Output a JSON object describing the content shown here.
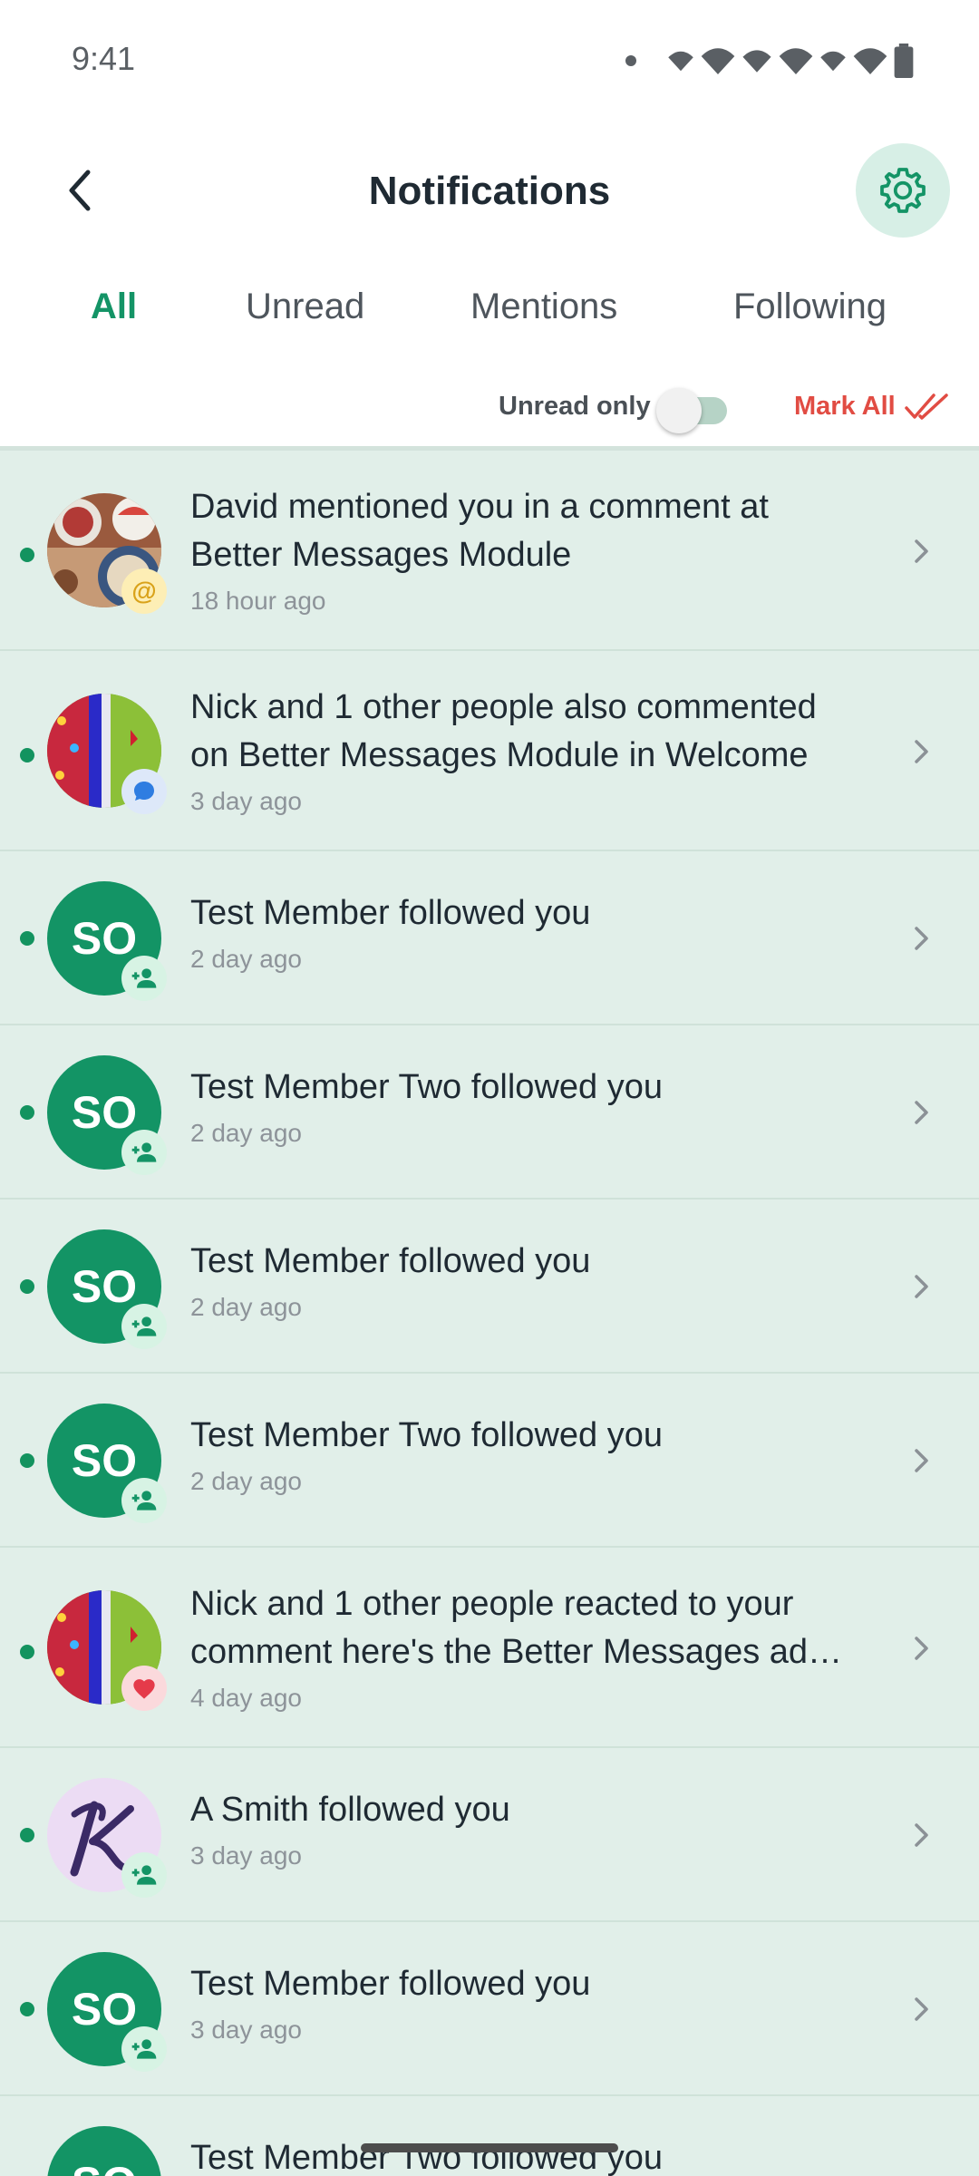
{
  "status_bar": {
    "time": "9:41"
  },
  "header": {
    "title": "Notifications"
  },
  "tabs": [
    {
      "label": "All",
      "active": true
    },
    {
      "label": "Unread",
      "active": false
    },
    {
      "label": "Mentions",
      "active": false
    },
    {
      "label": "Following",
      "active": false
    }
  ],
  "filters": {
    "unread_only_label": "Unread only",
    "unread_only_enabled": false,
    "mark_all_label": "Mark All"
  },
  "notifications": [
    {
      "title_lines": [
        "David mentioned you in a comment at",
        "Better Messages Module"
      ],
      "time": "18 hour ago",
      "avatar": "photo-fruit",
      "badge": "mention-icon",
      "unread": true
    },
    {
      "title_lines": [
        "Nick and 1 other people also commented",
        "on Better Messages Module in Welcome"
      ],
      "time": "3 day ago",
      "avatar": "photo-stadium",
      "badge": "comment-icon",
      "unread": true
    },
    {
      "title_lines": [
        "Test Member followed you"
      ],
      "time": "2 day ago",
      "avatar_initials": "SO",
      "badge": "follow-icon",
      "unread": true
    },
    {
      "title_lines": [
        "Test Member Two followed you"
      ],
      "time": "2 day ago",
      "avatar_initials": "SO",
      "badge": "follow-icon",
      "unread": true
    },
    {
      "title_lines": [
        "Test Member followed you"
      ],
      "time": "2 day ago",
      "avatar_initials": "SO",
      "badge": "follow-icon",
      "unread": true
    },
    {
      "title_lines": [
        "Test Member Two followed you"
      ],
      "time": "2 day ago",
      "avatar_initials": "SO",
      "badge": "follow-icon",
      "unread": true
    },
    {
      "title_lines": [
        "Nick and 1 other people reacted to your",
        "comment here's the Better Messages ad…"
      ],
      "time": "4 day ago",
      "avatar": "photo-stadium",
      "badge": "heart-icon",
      "unread": true
    },
    {
      "title_lines": [
        "A Smith followed you"
      ],
      "time": "3 day ago",
      "avatar_letter": "K",
      "badge": "follow-icon",
      "unread": true
    },
    {
      "title_lines": [
        "Test Member followed you"
      ],
      "time": "3 day ago",
      "avatar_initials": "SO",
      "badge": "follow-icon",
      "unread": true
    },
    {
      "title_lines": [
        "Test Member Two followed you"
      ],
      "time": "",
      "avatar_initials": "SO",
      "badge": "follow-icon",
      "unread": true
    }
  ],
  "colors": {
    "accent": "#149466",
    "mark_all": "#e14c43",
    "list_bg": "#e1efe9",
    "settings_bg": "#d7efe6"
  }
}
